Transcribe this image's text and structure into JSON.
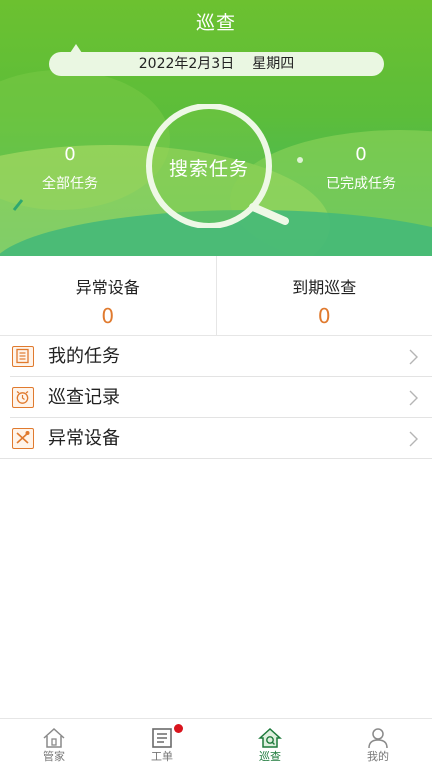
{
  "header": {
    "title": "巡查",
    "date": "2022年2月3日",
    "weekday": "星期四"
  },
  "stats": {
    "all_tasks": {
      "value": "0",
      "label": "全部任务"
    },
    "completed_tasks": {
      "value": "0",
      "label": "已完成任务"
    },
    "search_label": "搜索任务"
  },
  "summary": {
    "abnormal": {
      "label": "异常设备",
      "value": "0"
    },
    "due": {
      "label": "到期巡查",
      "value": "0"
    }
  },
  "menu": [
    {
      "label": "我的任务",
      "icon": "document-icon"
    },
    {
      "label": "巡查记录",
      "icon": "alarm-clock-icon"
    },
    {
      "label": "异常设备",
      "icon": "tools-icon"
    }
  ],
  "tabs": [
    {
      "label": "管家",
      "icon": "house-icon"
    },
    {
      "label": "工单",
      "icon": "work-order-icon"
    },
    {
      "label": "巡查",
      "icon": "patrol-house-icon"
    },
    {
      "label": "我的",
      "icon": "user-icon"
    }
  ],
  "colors": {
    "accent_green": "#5cbd3a",
    "accent_orange": "#e07a2e",
    "active_tab": "#1e7a3c",
    "badge_red": "#d9141d"
  }
}
